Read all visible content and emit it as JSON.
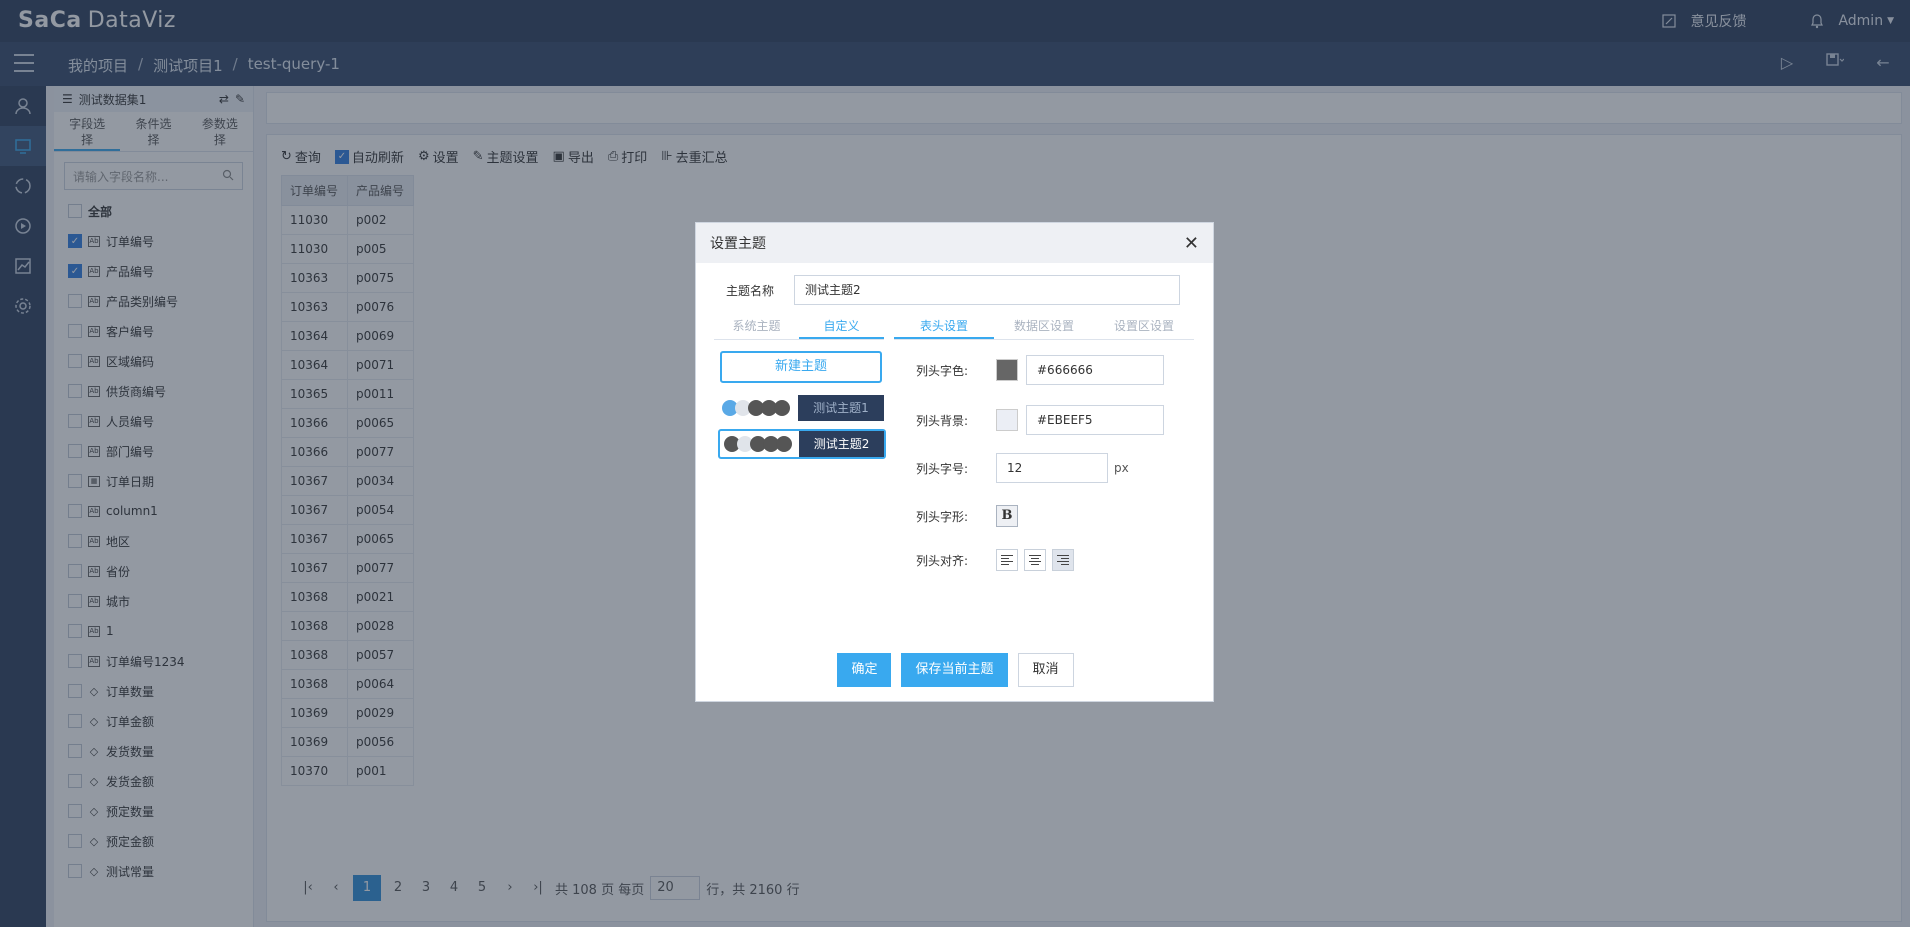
{
  "app": {
    "logo_main": "SaCa",
    "logo_sub": "DataViz"
  },
  "header": {
    "feedback": "意见反馈",
    "user": "Admin"
  },
  "breadcrumb": [
    "我的项目",
    "测试项目1",
    "test-query-1"
  ],
  "sidebar": {
    "dataset": "测试数据集1",
    "tabs": [
      "字段选择",
      "条件选择",
      "参数选择"
    ],
    "search_placeholder": "请输入字段名称...",
    "all_label": "全部",
    "fields": [
      {
        "label": "订单编号",
        "checked": true,
        "type": "text-icon"
      },
      {
        "label": "产品编号",
        "checked": true,
        "type": "text-icon"
      },
      {
        "label": "产品类别编号",
        "checked": false,
        "type": "text-icon"
      },
      {
        "label": "客户编号",
        "checked": false,
        "type": "text-icon"
      },
      {
        "label": "区域编码",
        "checked": false,
        "type": "text-icon"
      },
      {
        "label": "供货商编号",
        "checked": false,
        "type": "text-icon"
      },
      {
        "label": "人员编号",
        "checked": false,
        "type": "text-icon"
      },
      {
        "label": "部门编号",
        "checked": false,
        "type": "text-icon"
      },
      {
        "label": "订单日期",
        "checked": false,
        "type": "date-icon"
      },
      {
        "label": "column1",
        "checked": false,
        "type": "text-icon"
      },
      {
        "label": "地区",
        "checked": false,
        "type": "text-icon"
      },
      {
        "label": "省份",
        "checked": false,
        "type": "text-icon"
      },
      {
        "label": "城市",
        "checked": false,
        "type": "text-icon"
      },
      {
        "label": "1",
        "checked": false,
        "type": "text-icon"
      },
      {
        "label": "订单编号1234",
        "checked": false,
        "type": "text-icon"
      },
      {
        "label": "订单数量",
        "checked": false,
        "type": "measure-icon"
      },
      {
        "label": "订单金额",
        "checked": false,
        "type": "measure-icon"
      },
      {
        "label": "发货数量",
        "checked": false,
        "type": "measure-icon"
      },
      {
        "label": "发货金额",
        "checked": false,
        "type": "measure-icon"
      },
      {
        "label": "预定数量",
        "checked": false,
        "type": "measure-icon"
      },
      {
        "label": "预定金额",
        "checked": false,
        "type": "measure-icon"
      },
      {
        "label": "测试常量",
        "checked": false,
        "type": "measure-icon"
      }
    ]
  },
  "toolbar": {
    "query": "查询",
    "auto_refresh": "自动刷新",
    "settings": "设置",
    "theme_settings": "主题设置",
    "export": "导出",
    "print": "打印",
    "dedup": "去重汇总"
  },
  "table": {
    "columns": [
      "订单编号",
      "产品编号"
    ],
    "rows": [
      [
        "11030",
        "p002"
      ],
      [
        "11030",
        "p005"
      ],
      [
        "10363",
        "p0075"
      ],
      [
        "10363",
        "p0076"
      ],
      [
        "10364",
        "p0069"
      ],
      [
        "10364",
        "p0071"
      ],
      [
        "10365",
        "p0011"
      ],
      [
        "10366",
        "p0065"
      ],
      [
        "10366",
        "p0077"
      ],
      [
        "10367",
        "p0034"
      ],
      [
        "10367",
        "p0054"
      ],
      [
        "10367",
        "p0065"
      ],
      [
        "10367",
        "p0077"
      ],
      [
        "10368",
        "p0021"
      ],
      [
        "10368",
        "p0028"
      ],
      [
        "10368",
        "p0057"
      ],
      [
        "10368",
        "p0064"
      ],
      [
        "10369",
        "p0029"
      ],
      [
        "10369",
        "p0056"
      ],
      [
        "10370",
        "p001"
      ]
    ]
  },
  "pager": {
    "pages": [
      "1",
      "2",
      "3",
      "4",
      "5"
    ],
    "current": "1",
    "total_pages_text": "共 108 页 每页",
    "page_size": "20",
    "rows_text": "行，共 2160 行"
  },
  "dialog": {
    "title": "设置主题",
    "name_label": "主题名称",
    "name_value": "测试主题2",
    "left_tabs": [
      "系统主题",
      "自定义"
    ],
    "right_tabs": [
      "表头设置",
      "数据区设置",
      "设置区设置"
    ],
    "new_theme": "新建主题",
    "themes": [
      {
        "name": "测试主题1",
        "dots": [
          "#5aa9e6",
          "#e0e4ea",
          "#555555",
          "#555555",
          "#555555"
        ]
      },
      {
        "name": "测试主题2",
        "dots": [
          "#555555",
          "#e0e4ea",
          "#555555",
          "#555555",
          "#555555"
        ]
      }
    ],
    "props": {
      "font_color_label": "列头字色:",
      "font_color_value": "#666666",
      "font_color_swatch": "#666666",
      "bg_label": "列头背景:",
      "bg_value": "#EBEEF5",
      "bg_swatch": "#EBEEF5",
      "size_label": "列头字号:",
      "size_value": "12",
      "size_unit": "px",
      "style_label": "列头字形:",
      "bold_glyph": "B",
      "align_label": "列头对齐:"
    },
    "buttons": {
      "ok": "确定",
      "save": "保存当前主题",
      "cancel": "取消"
    }
  },
  "colors": {
    "accent": "#39a9ef",
    "navy": "#2c3e5c"
  }
}
